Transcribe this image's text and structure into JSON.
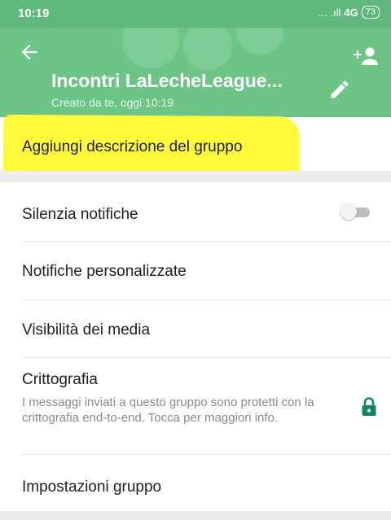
{
  "status_bar": {
    "time": "10:19",
    "signal": "... .ıll",
    "network": "4G",
    "battery": "73"
  },
  "header": {
    "title": "Incontri LaLecheLeague...",
    "subtitle": "Creato da te, oggi 10:19"
  },
  "description_prompt": "Aggiungi descrizione del gruppo",
  "settings": {
    "mute_label": "Silenzia notifiche",
    "mute_on": false,
    "custom_notifications_label": "Notifiche personalizzate",
    "media_visibility_label": "Visibilità dei media",
    "encryption_label": "Crittografia",
    "encryption_desc": "I messaggi inviati a questo gruppo sono protetti con la crittografia end-to-end. Tocca per maggiori info.",
    "group_settings_label": "Impostazioni gruppo"
  },
  "icons": {
    "back": "arrow-back-icon",
    "add_participant": "add-person-icon",
    "edit": "pencil-icon",
    "lock": "lock-icon"
  },
  "colors": {
    "header_bg": "#6cc587",
    "status_bg": "#5fb97c",
    "highlight": "#fff93a",
    "lock": "#0c8a5e"
  }
}
